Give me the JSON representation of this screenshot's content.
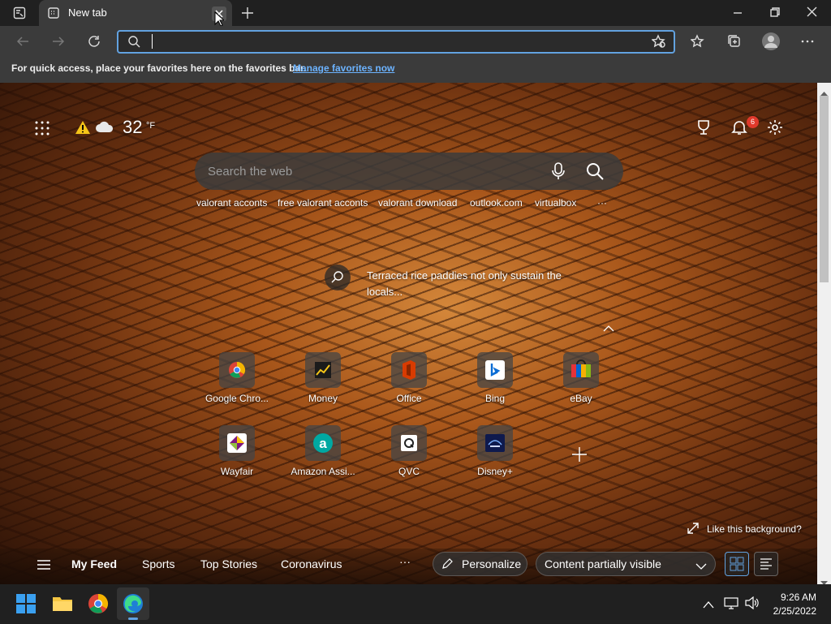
{
  "browser": {
    "tab_title": "New tab",
    "favorites_bar_text": "For quick access, place your favorites here on the favorites bar.",
    "favorites_bar_link": "Manage favorites now",
    "address_value": ""
  },
  "newtab": {
    "weather_temp": "32",
    "weather_unit": "°F",
    "search_placeholder": "Search the web",
    "trending": [
      "valorant acconts",
      "free valorant acconts",
      "valorant download",
      "outlook.com",
      "virtualbox"
    ],
    "trending_more": "···",
    "notification_count": "6",
    "image_caption_line1": "Terraced rice paddies not only sustain the",
    "image_caption_line2": "locals...",
    "tiles_row1": [
      "Google Chro...",
      "Money",
      "Office",
      "Bing",
      "eBay"
    ],
    "tiles_row2": [
      "Wayfair",
      "Amazon Assi...",
      "QVC",
      "Disney+"
    ],
    "like_background": "Like this background?",
    "feed": {
      "items": [
        "My Feed",
        "Sports",
        "Top Stories",
        "Coronavirus"
      ],
      "more": "···",
      "personalize": "Personalize",
      "visibility": "Content partially visible"
    }
  },
  "taskbar": {
    "time": "9:26 AM",
    "date": "2/25/2022"
  },
  "colors": {
    "accent": "#62a2e0",
    "link": "#6cb3ff",
    "badge": "#e0392b"
  }
}
